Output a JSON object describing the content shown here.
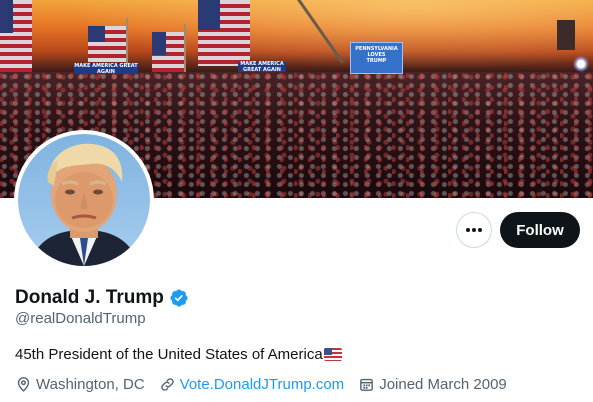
{
  "banner": {
    "description_alt": "",
    "signs": [
      "MAKE AMERICA GREAT AGAIN",
      "MAKE AMERICA GREAT AGAIN"
    ],
    "jumbotron": [
      "PENNSYLVANIA",
      "LOVES",
      "TRUMP"
    ]
  },
  "profile": {
    "display_name": "Donald J. Trump",
    "handle": "@realDonaldTrump",
    "bio": "45th President of the United States of America",
    "location": "Washington, DC",
    "website": "Vote.DonaldJTrump.com",
    "joined": "Joined March 2009",
    "verified": true
  },
  "actions": {
    "more_label": "•••",
    "follow_label": "Follow"
  },
  "colors": {
    "accent": "#1d9bf0",
    "text_primary": "#0f1419",
    "text_secondary": "#536471",
    "follow_bg": "#0f1419"
  },
  "icons": {
    "location": "location-pin-icon",
    "link": "link-icon",
    "calendar": "calendar-icon",
    "verified": "verified-badge-icon",
    "more": "more-horizontal-icon"
  }
}
